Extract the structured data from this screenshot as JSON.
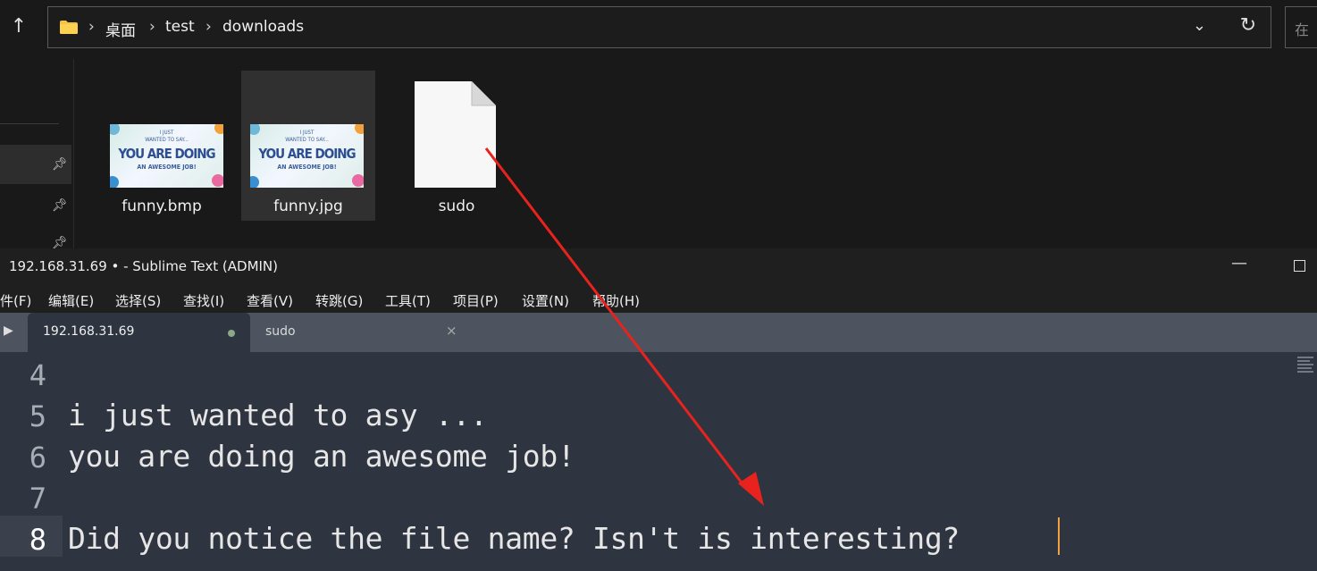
{
  "explorer": {
    "up_icon": "arrow-up-icon",
    "breadcrumb": [
      "桌面",
      "test",
      "downloads"
    ],
    "breadcrumb_sep": "›",
    "search_placeholder": "在",
    "files": [
      {
        "name": "funny.bmp",
        "thumb_lines": [
          "I JUST",
          "WANTED TO SAY...",
          "YOU ARE DOING",
          "AN AWESOME JOB!"
        ]
      },
      {
        "name": "funny.jpg",
        "thumb_lines": [
          "I JUST",
          "WANTED TO SAY...",
          "YOU ARE DOING",
          "AN AWESOME JOB!"
        ]
      },
      {
        "name": "sudo"
      }
    ]
  },
  "sublime": {
    "title": "192.168.31.69 • - Sublime Text (ADMIN)",
    "menu": [
      "件(F)",
      "编辑(E)",
      "选择(S)",
      "查找(I)",
      "查看(V)",
      "转跳(G)",
      "工具(T)",
      "项目(P)",
      "设置(N)",
      "帮助(H)"
    ],
    "tabs": [
      {
        "label": "192.168.31.69",
        "modified": true
      },
      {
        "label": "sudo",
        "close": "×"
      }
    ],
    "lines": [
      {
        "num": "4",
        "text": ""
      },
      {
        "num": "5",
        "text": "i just wanted to asy ..."
      },
      {
        "num": "6",
        "text": "you are doing an awesome job!"
      },
      {
        "num": "7",
        "text": ""
      },
      {
        "num": "8",
        "text": "Did you notice the file name? Isn't is interesting?"
      }
    ],
    "current_line": "8"
  },
  "colors": {
    "annotation_arrow": "#e8231d",
    "caret": "#f3a040",
    "editor_bg": "#2f3540"
  }
}
